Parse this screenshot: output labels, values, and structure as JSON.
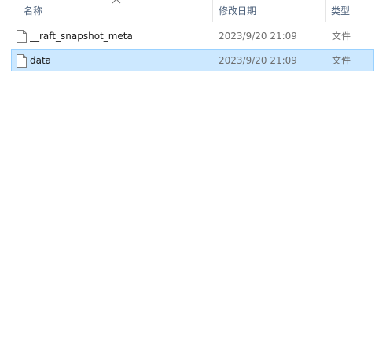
{
  "columns": {
    "name": "名称",
    "date": "修改日期",
    "type": "类型"
  },
  "sort": {
    "column": "name",
    "icon": "chevron-up-icon"
  },
  "files": [
    {
      "name": "__raft_snapshot_meta",
      "modified": "2023/9/20 21:09",
      "type": "文件",
      "icon": "file-icon",
      "selected": false
    },
    {
      "name": "data",
      "modified": "2023/9/20 21:09",
      "type": "文件",
      "icon": "file-icon",
      "selected": true
    }
  ],
  "colors": {
    "selection_background": "#cce8ff",
    "selection_border": "#99d1ff",
    "header_text": "#4c607a"
  }
}
